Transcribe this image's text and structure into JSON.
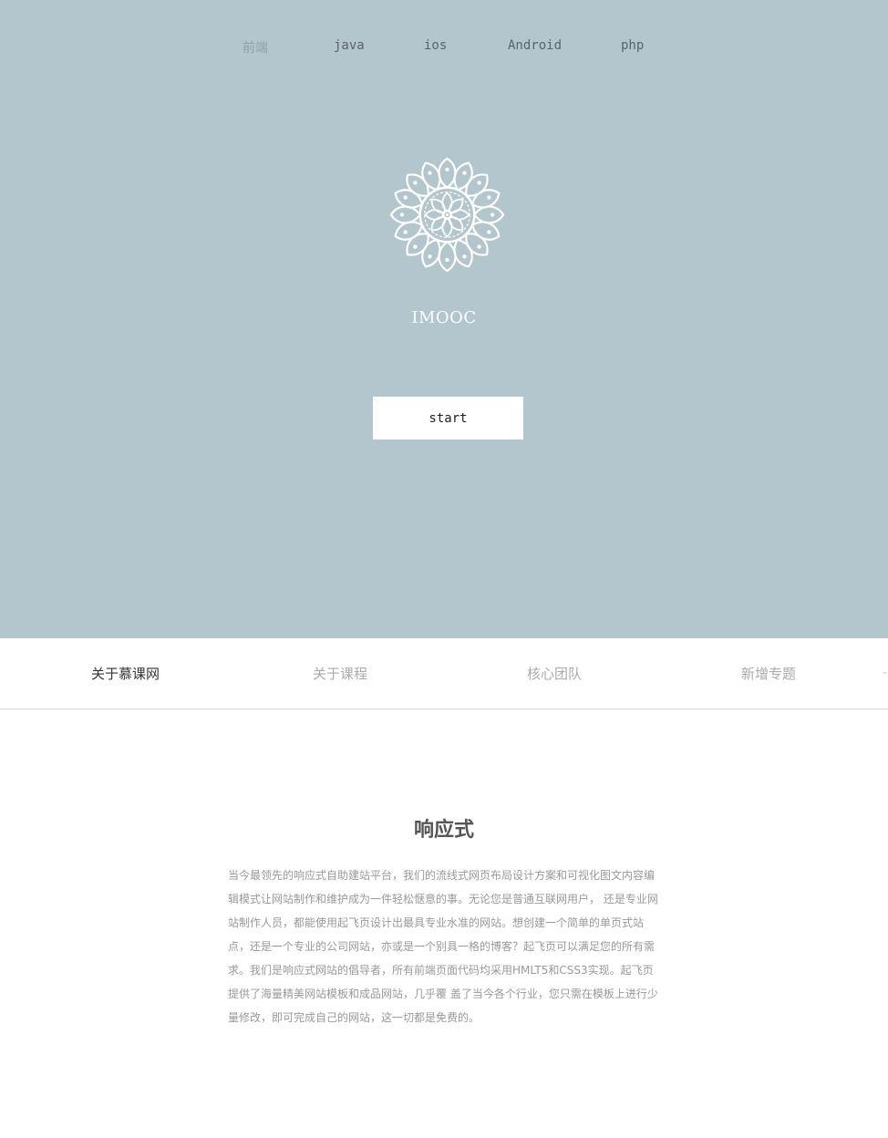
{
  "topnav": {
    "items": [
      {
        "label": "前端",
        "active": true
      },
      {
        "label": "java",
        "active": false
      },
      {
        "label": "ios",
        "active": false
      },
      {
        "label": "Android",
        "active": false
      },
      {
        "label": "php",
        "active": false
      }
    ]
  },
  "hero": {
    "logo_icon": "lace-mandala-icon",
    "brand": "IMOOC",
    "start_label": "start",
    "background": "#b3c6ce"
  },
  "tabs": {
    "items": [
      {
        "label": "关于慕课网",
        "active": true
      },
      {
        "label": "关于课程",
        "active": false
      },
      {
        "label": "核心团队",
        "active": false
      },
      {
        "label": "新增专题",
        "active": false
      }
    ]
  },
  "section": {
    "title": "响应式",
    "body": "当今最领先的响应式自助建站平台，我们的流线式网页布局设计方案和可视化图文内容编辑模式让网站制作和维护成为一件轻松惬意的事。无论您是普通互联网用户， 还是专业网站制作人员，都能使用起飞页设计出最具专业水准的网站。想创建一个简单的单页式站点，还是一个专业的公司网站，亦或是一个别具一格的博客？起飞页可以满足您的所有需求。我们是响应式网站的倡导者，所有前端页面代码均采用HMLT5和CSS3实现。起飞页提供了海量精美网站模板和成品网站，几乎覆 盖了当今各个行业，您只需在模板上进行少量修改，即可完成自己的网站，这一切都是免费的。"
  }
}
